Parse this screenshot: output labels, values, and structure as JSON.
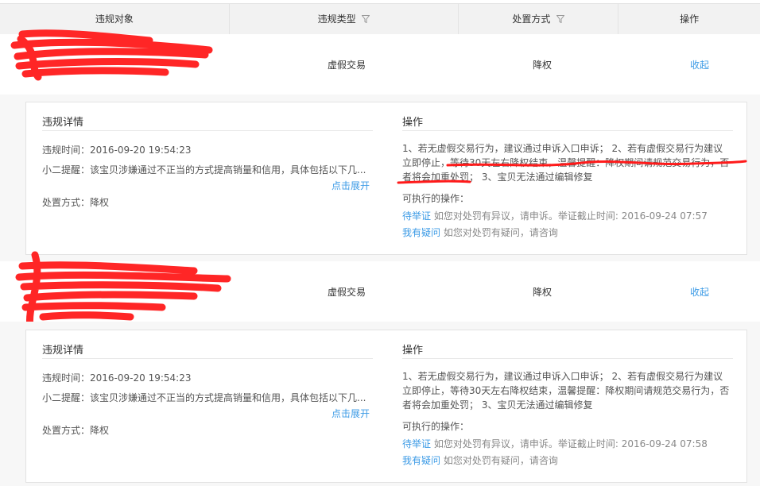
{
  "header": {
    "col_object": "违规对象",
    "col_type": "违规类型",
    "col_method": "处置方式",
    "col_action": "操作"
  },
  "records": [
    {
      "type": "虚假交易",
      "method": "降权",
      "collapse_label": "收起",
      "detail": {
        "title": "违规详情",
        "time_label": "违规时间：",
        "time": "2016-09-20 19:54:23",
        "reminder_label": "小二提醒：",
        "reminder": "该宝贝涉嫌通过不正当的方式提高销量和信用，具体包括以下几...",
        "expand_label": "点击展开",
        "method_label": "处置方式：",
        "method": "降权"
      },
      "ops": {
        "title": "操作",
        "line1": "1、若无虚假交易行为，建议通过申诉入口申诉； 2、若有虚假交易行为建议",
        "line2": "立即停止，等待30天左右降权结束，温馨提醒：降权期间请规范交易行为，否",
        "line3": "者将会加重处罚； 3、宝贝无法通过编辑修复",
        "available_label": "可执行的操作：",
        "pending_link": "待举证",
        "pending_text": "如您对处罚有异议，请申诉。举证截止时间: 2016-09-24 07:57",
        "question_link": "我有疑问",
        "question_text": "如您对处罚有疑问，请咨询"
      }
    },
    {
      "type": "虚假交易",
      "method": "降权",
      "collapse_label": "收起",
      "detail": {
        "title": "违规详情",
        "time_label": "违规时间：",
        "time": "2016-09-20 19:54:23",
        "reminder_label": "小二提醒：",
        "reminder": "该宝贝涉嫌通过不正当的方式提高销量和信用，具体包括以下几...",
        "expand_label": "点击展开",
        "method_label": "处置方式：",
        "method": "降权"
      },
      "ops": {
        "title": "操作",
        "line1": "1、若无虚假交易行为，建议通过申诉入口申诉； 2、若有虚假交易行为建议",
        "line2": "立即停止，等待30天左右降权结束，温馨提醒：降权期间请规范交易行为，否",
        "line3": "者将会加重处罚； 3、宝贝无法通过编辑修复",
        "available_label": "可执行的操作：",
        "pending_link": "待举证",
        "pending_text": "如您对处罚有异议，请申诉。举证截止时间: 2016-09-24 07:58",
        "question_link": "我有疑问",
        "question_text": "如您对处罚有疑问，请咨询"
      }
    }
  ],
  "colors": {
    "link": "#3c9be6",
    "redaction": "#ff0000",
    "header_bg": "#f2f2f2"
  }
}
